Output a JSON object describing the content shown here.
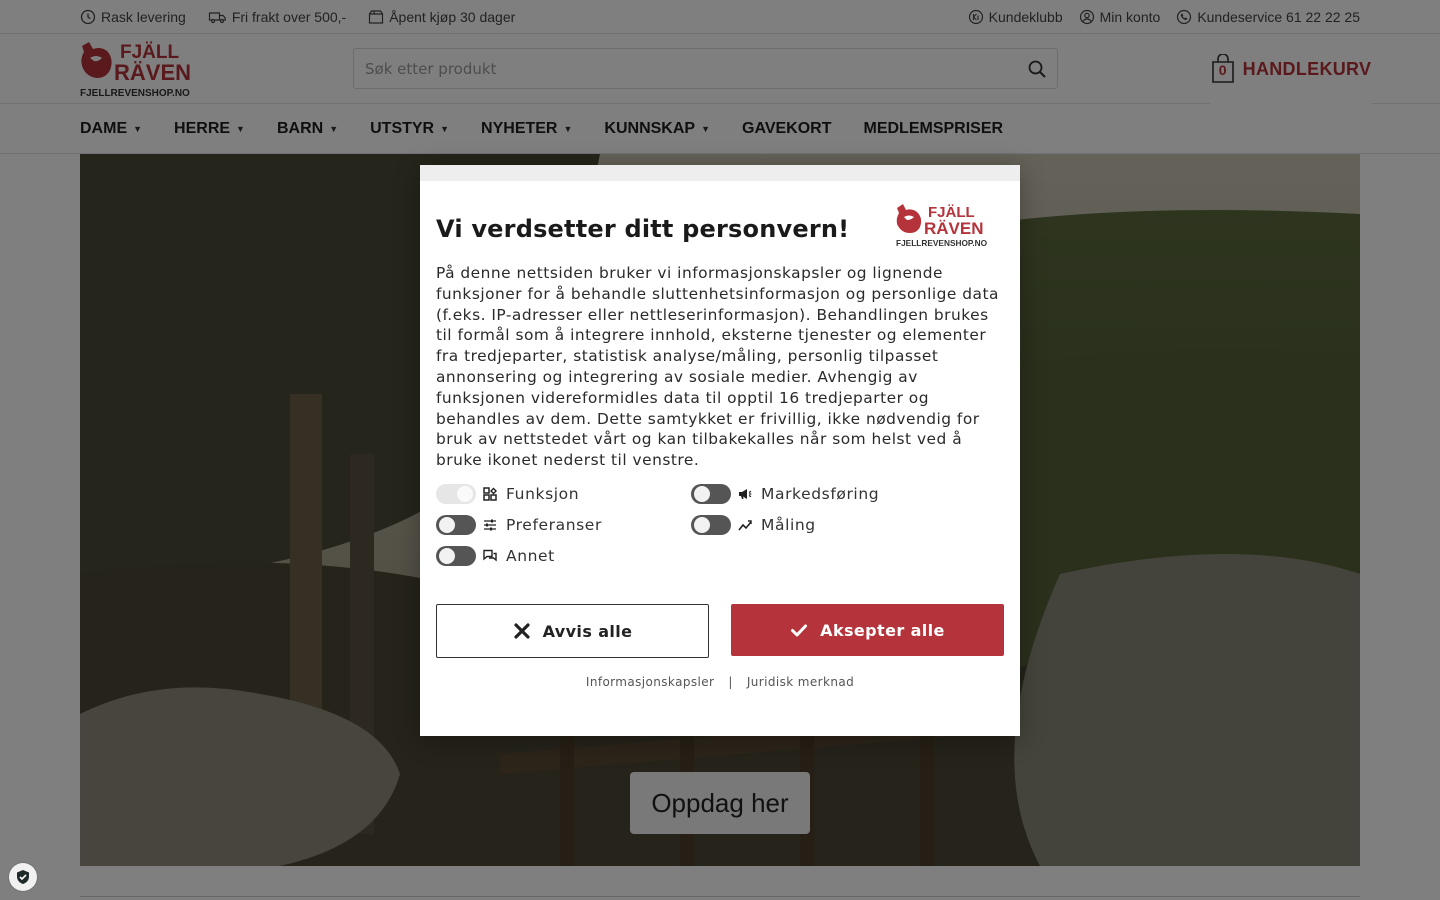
{
  "topbar": {
    "left": [
      {
        "icon": "clock-icon",
        "label": "Rask levering"
      },
      {
        "icon": "truck-icon",
        "label": "Fri frakt over 500,-"
      },
      {
        "icon": "package-icon",
        "label": "Åpent kjøp 30 dager"
      }
    ],
    "right": [
      {
        "icon": "club-icon",
        "label": "Kundeklubb"
      },
      {
        "icon": "user-icon",
        "label": "Min konto"
      },
      {
        "icon": "phone-icon",
        "label": "Kundeservice 61 22 22 25"
      }
    ]
  },
  "brand": {
    "logo_text_1": "FJÄLL",
    "logo_text_2": "RÄVEN",
    "logo_sub": "FJELLREVENSHOP.NO",
    "accent": "#b5333a"
  },
  "search": {
    "placeholder": "Søk etter produkt"
  },
  "cart": {
    "count": "0",
    "label": "HANDLEKURV"
  },
  "nav": [
    {
      "label": "DAME",
      "dropdown": true
    },
    {
      "label": "HERRE",
      "dropdown": true
    },
    {
      "label": "BARN",
      "dropdown": true
    },
    {
      "label": "UTSTYR",
      "dropdown": true
    },
    {
      "label": "NYHETER",
      "dropdown": true
    },
    {
      "label": "KUNNSKAP",
      "dropdown": true
    },
    {
      "label": "GAVEKORT",
      "dropdown": false
    },
    {
      "label": "MEDLEMSPRISER",
      "dropdown": false
    }
  ],
  "hero": {
    "button_label": "Oppdag her"
  },
  "consent": {
    "title": "Vi verdsetter ditt personvern!",
    "body": "På denne nettsiden bruker vi informasjonskapsler og lignende funksjoner for å behandle sluttenhetsinformasjon og personlige data (f.eks. IP-adresser eller nettleserinformasjon). Behandlingen brukes til formål som å integrere innhold, eksterne tjenester og elementer fra tredjeparter, statistisk analyse/måling, personlig tilpasset annonsering og integrering av sosiale medier. Avhengig av funksjonen videreformidles data til opptil 16 tredjeparter og behandles av dem. Dette samtykket er frivillig, ikke nødvendig for bruk av nettstedet vårt og kan tilbakekalles når som helst ved å bruke ikonet nederst til venstre.",
    "categories": [
      {
        "label": "Funksjon",
        "icon": "function-icon",
        "enabled": true,
        "locked": true
      },
      {
        "label": "Markedsføring",
        "icon": "megaphone-icon",
        "enabled": false,
        "locked": false
      },
      {
        "label": "Preferanser",
        "icon": "sliders-icon",
        "enabled": false,
        "locked": false
      },
      {
        "label": "Måling",
        "icon": "chart-line-icon",
        "enabled": false,
        "locked": false
      },
      {
        "label": "Annet",
        "icon": "chat-icon",
        "enabled": false,
        "locked": false
      }
    ],
    "reject_label": "Avvis alle",
    "accept_label": "Aksepter alle",
    "links": [
      "Informasjonskapsler",
      "Juridisk merknad"
    ],
    "link_separator": "|"
  }
}
